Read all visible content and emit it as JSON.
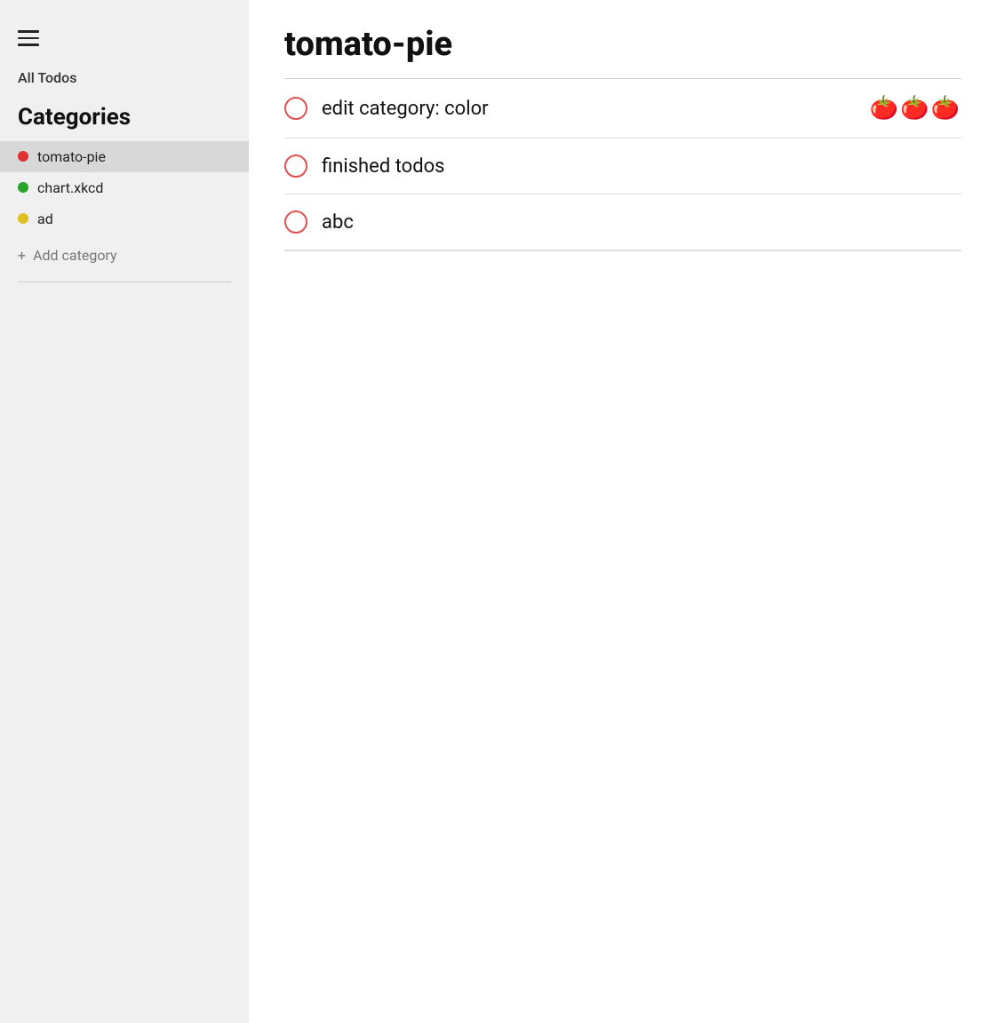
{
  "sidebar": {
    "all_todos_label": "All Todos",
    "categories_heading": "Categories",
    "categories": [
      {
        "id": "tomato-pie",
        "label": "tomato-pie",
        "color": "#e03030",
        "active": true
      },
      {
        "id": "chart-xkcd",
        "label": "chart.xkcd",
        "color": "#28a428",
        "active": false
      },
      {
        "id": "ad",
        "label": "ad",
        "color": "#e0c020",
        "active": false
      }
    ],
    "add_category_label": "Add category"
  },
  "main": {
    "title": "tomato-pie",
    "todos": [
      {
        "id": 1,
        "text": "edit category: color",
        "emoji": "🍅🍅🍅",
        "checked": false
      },
      {
        "id": 2,
        "text": "finished todos",
        "emoji": "",
        "checked": false
      },
      {
        "id": 3,
        "text": "abc",
        "emoji": "",
        "checked": false
      }
    ]
  },
  "icons": {
    "hamburger": "☰",
    "plus": "+"
  }
}
